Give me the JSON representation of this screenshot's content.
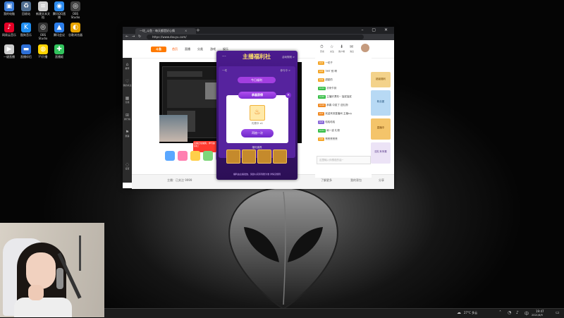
{
  "desktop": {
    "icons": [
      {
        "label": "我的电脑",
        "glyph": "▣",
        "color": "#3a7bd5"
      },
      {
        "label": "回收站",
        "glyph": "♻",
        "color": "#4f6d8f"
      },
      {
        "label": "新建文本文档",
        "glyph": "≡",
        "color": "#cfcfcf"
      },
      {
        "label": "腾讯QQ直播",
        "glyph": "◉",
        "color": "#2d8cf0"
      },
      {
        "label": "OBS Studio",
        "glyph": "◎",
        "color": "#444444"
      },
      {
        "label": "网易云音乐",
        "glyph": "♪",
        "color": "#e60026"
      },
      {
        "label": "酷狗音乐",
        "glyph": "K",
        "color": "#1f8ef1"
      },
      {
        "label": "OBS Studio",
        "glyph": "◎",
        "color": "#333333"
      },
      {
        "label": "腾讯会议",
        "glyph": "▲",
        "color": "#2b7de9"
      },
      {
        "label": "谷歌浏览器",
        "glyph": "◐",
        "color": "#e8a400"
      },
      {
        "label": "一键直播",
        "glyph": "▶",
        "color": "#cccccc"
      },
      {
        "label": "直播伴侣",
        "glyph": "▬",
        "color": "#2d6fd6"
      },
      {
        "label": "YY开播",
        "glyph": "◍",
        "color": "#ffd400"
      },
      {
        "label": "直播姬",
        "glyph": "✚",
        "color": "#32c35d"
      }
    ]
  },
  "browser": {
    "tab_title": "一坨_斗鱼 - 每天都是好心情",
    "tab_close": "×",
    "new_tab": "+",
    "window_controls": "– ▢ ✕",
    "back": "←",
    "forward": "→",
    "reload": "↻",
    "url": "https://www.douyu.com/",
    "site": {
      "logo": "斗鱼",
      "nav": [
        "首页",
        "直播",
        "分类",
        "游戏",
        "娱乐"
      ],
      "header_icons": [
        {
          "glyph": "⏱",
          "label": "历史"
        },
        {
          "glyph": "☆",
          "label": "关注"
        },
        {
          "glyph": "⬇",
          "label": "客户端"
        },
        {
          "glyph": "✉",
          "label": "消息"
        }
      ],
      "sidebar": [
        {
          "glyph": "⌂",
          "label": "推荐"
        },
        {
          "glyph": "♡",
          "label": "我的关注"
        },
        {
          "glyph": "▦",
          "label": "分类"
        },
        {
          "glyph": "⊞",
          "label": "排行榜"
        },
        {
          "glyph": "⚑",
          "label": "赛事"
        },
        {
          "glyph": "◌",
          "label": "设置"
        }
      ],
      "stream_tag": "主播正在抽奖，参与赢好礼！",
      "footer": {
        "left": "主播：已关注 9999",
        "mid": "了解更多",
        "right": "我的背包",
        "far_right": "分享"
      },
      "chat": [
        {
          "badge": "LV1",
          "badge_color": "#f4a62a",
          "text": "一坨子"
        },
        {
          "badge": "LV5",
          "badge_color": "#f4a62a",
          "text": "TMT 别 啊"
        },
        {
          "badge": "LV9",
          "badge_color": "#f4a62a",
          "text": "甜甜的"
        },
        {
          "badge": "LV12",
          "badge_color": "#3bbf4a",
          "text": "初来乍到"
        },
        {
          "badge": "LV20",
          "badge_color": "#3bbf4a",
          "text": "主播好漂亮~ 抽奖抽奖"
        },
        {
          "badge": "LV18",
          "badge_color": "#f08a24",
          "text": "恭喜 中奖了 送礼物"
        },
        {
          "badge": "LV7",
          "badge_color": "#f08a24",
          "text": "欢迎来到直播间 主播sry"
        },
        {
          "badge": "LV3",
          "badge_color": "#8a6ad8",
          "text": "哈哈哈哈"
        },
        {
          "badge": "LV11",
          "badge_color": "#3bbf4a",
          "text": "刷一波 礼物"
        },
        {
          "badge": "LV6",
          "badge_color": "#f4a62a",
          "text": "赞赞赞赞赞"
        }
      ],
      "chat_placeholder": "这里输入你想说的话~",
      "right_cards": [
        {
          "text": "超级福利",
          "color": "#f3d28a"
        },
        {
          "text": "粉丝团",
          "color": "#b7d9f4"
        },
        {
          "text": "直播中",
          "color": "#f4c46a"
        },
        {
          "text": "送礼有惊喜",
          "color": "#ece3f6"
        }
      ]
    }
  },
  "popup": {
    "title": "主播福利社",
    "menu": "···",
    "rule": "活动规则 >",
    "head_left": "一坨",
    "head_right": "参与中 >",
    "pill": "今日福利",
    "card_title": "恭喜获得",
    "card_close": "×",
    "prize_glyph": "♨",
    "prize_text": "礼物卡 x1",
    "card_button": "再抽一次",
    "slot_label": "福利道具",
    "footer": "福利由主播发放，奖励以实际到账为准 详情见规则"
  },
  "taskbar": {
    "weather": "27°C 多云",
    "time": "19:47",
    "date": "2021/6/9"
  }
}
